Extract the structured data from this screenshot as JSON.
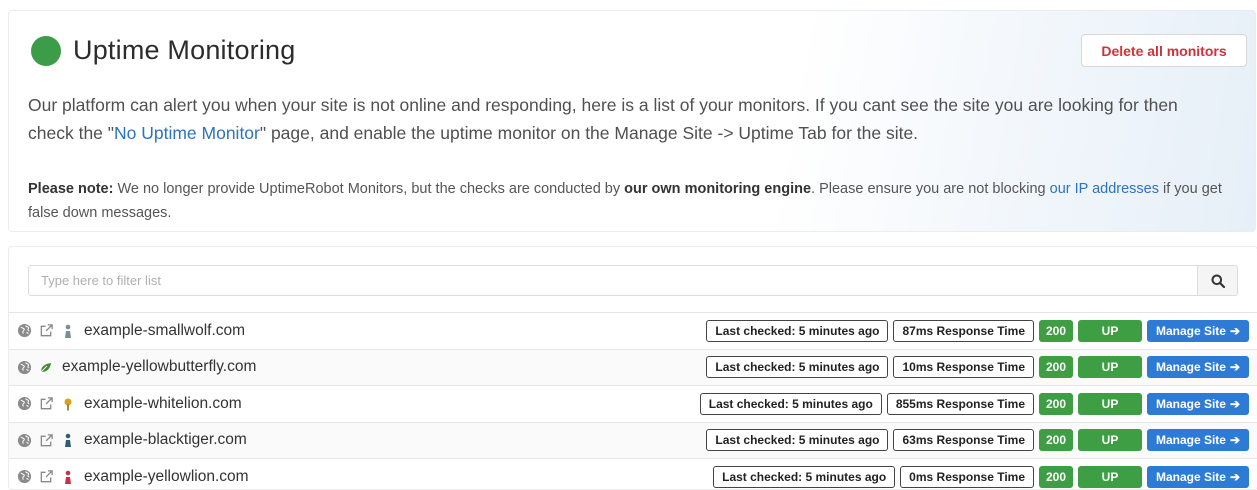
{
  "header": {
    "title": "Uptime Monitoring",
    "delete_label": "Delete all monitors",
    "status_color": "#3c9c48"
  },
  "intro": {
    "part1": "Our platform can alert you when your site is not online and responding, here is a list of your monitors. If you cant see the site you are looking for then check the \"",
    "link": "No Uptime Monitor",
    "part2": "\" page, and enable the uptime monitor on the Manage Site -> Uptime Tab for the site."
  },
  "note": {
    "label": "Please note:",
    "part1": " We no longer provide UptimeRobot Monitors, but the checks are conducted by ",
    "bold": "our own monitoring engine",
    "part2": ". Please ensure you are not blocking ",
    "link": "our IP addresses",
    "part3": " if you get false down messages."
  },
  "filter": {
    "placeholder": "Type here to filter list",
    "value": ""
  },
  "monitors": [
    {
      "domain": "example-smallwolf.com",
      "last_checked": "Last checked: 5 minutes ago",
      "response": "87ms Response Time",
      "code": "200",
      "status": "UP",
      "manage": "Manage Site",
      "favicon": "person-icon",
      "favicon_color": "#7a8c99",
      "external_link": true
    },
    {
      "domain": "example-yellowbutterfly.com",
      "last_checked": "Last checked: 5 minutes ago",
      "response": "10ms Response Time",
      "code": "200",
      "status": "UP",
      "manage": "Manage Site",
      "favicon": "leaf-icon",
      "favicon_color": "#3e8a32",
      "external_link": false
    },
    {
      "domain": "example-whitelion.com",
      "last_checked": "Last checked: 5 minutes ago",
      "response": "855ms Response Time",
      "code": "200",
      "status": "UP",
      "manage": "Manage Site",
      "favicon": "pin-icon",
      "favicon_color": "#d9a21a",
      "external_link": true
    },
    {
      "domain": "example-blacktiger.com",
      "last_checked": "Last checked: 5 minutes ago",
      "response": "63ms Response Time",
      "code": "200",
      "status": "UP",
      "manage": "Manage Site",
      "favicon": "person-icon",
      "favicon_color": "#2e5d73",
      "external_link": true
    },
    {
      "domain": "example-yellowlion.com",
      "last_checked": "Last checked: 5 minutes ago",
      "response": "0ms Response Time",
      "code": "200",
      "status": "UP",
      "manage": "Manage Site",
      "favicon": "person-icon",
      "favicon_color": "#c4324c",
      "external_link": true
    }
  ]
}
